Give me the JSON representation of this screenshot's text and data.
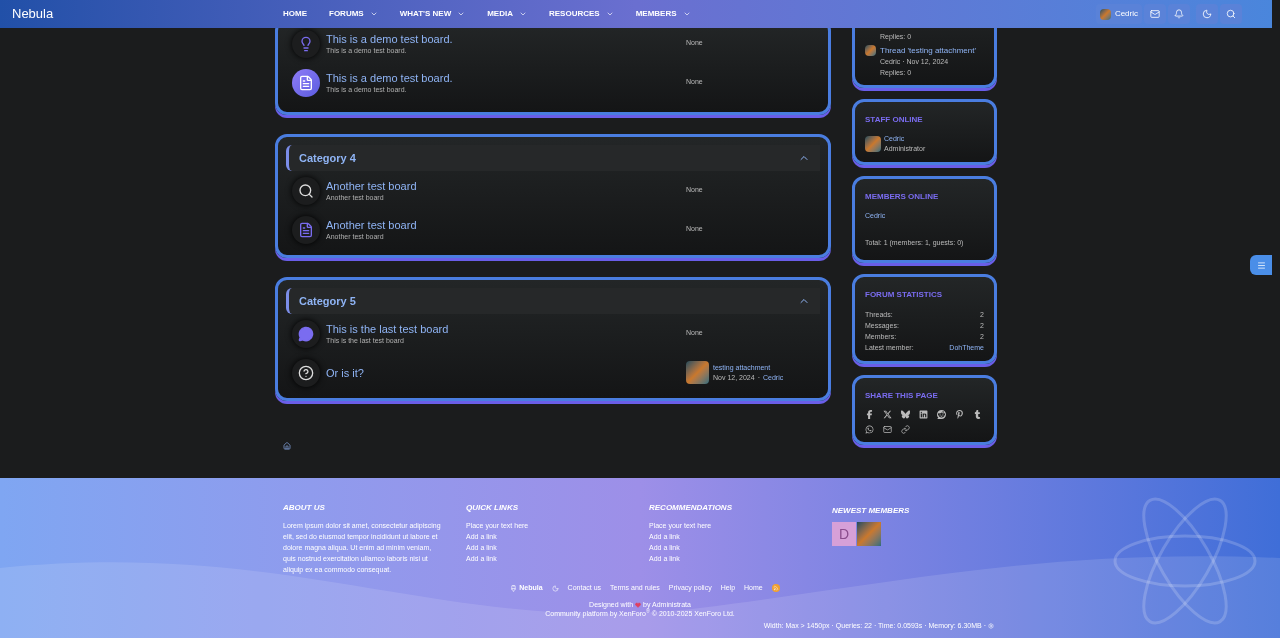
{
  "header": {
    "logo": "Nebula",
    "nav": [
      {
        "label": "HOME",
        "has_menu": false
      },
      {
        "label": "FORUMS",
        "has_menu": true
      },
      {
        "label": "WHAT'S NEW",
        "has_menu": true
      },
      {
        "label": "MEDIA",
        "has_menu": true
      },
      {
        "label": "RESOURCES",
        "has_menu": true
      },
      {
        "label": "MEMBERS",
        "has_menu": true
      }
    ],
    "user": "Cedric"
  },
  "categories": [
    {
      "boards": [
        {
          "highlighted": false,
          "title": "This is a demo test board.",
          "description": "This is a demo test board.",
          "last_post": {
            "kind": "none",
            "text": "None"
          }
        },
        {
          "highlighted": true,
          "title": "This is a demo test board.",
          "description": "This is a demo test board.",
          "last_post": {
            "kind": "none",
            "text": "None"
          }
        }
      ]
    },
    {
      "title": "Category 4",
      "boards": [
        {
          "highlighted": false,
          "title": "Another test board",
          "description": "Another test board",
          "last_post": {
            "kind": "none",
            "text": "None"
          }
        },
        {
          "highlighted": false,
          "title": "Another test board",
          "description": "Another test board",
          "last_post": {
            "kind": "none",
            "text": "None"
          }
        }
      ]
    },
    {
      "title": "Category 5",
      "boards": [
        {
          "highlighted": false,
          "title": "This is the last test board",
          "description": "This is the last test board",
          "last_post": {
            "kind": "none",
            "text": "None"
          }
        },
        {
          "highlighted": false,
          "title": "Or is it?",
          "last_post": {
            "kind": "post",
            "title": "testing attachment",
            "date": "Nov 12, 2024",
            "separator": "·",
            "user": "Cedric"
          }
        }
      ]
    }
  ],
  "sidebar": {
    "latest_posts": [
      {
        "replies": "Replies: 0"
      },
      {
        "title": "Thread 'testing attachment'",
        "meta": "Cedric · Nov 12, 2024",
        "replies": "Replies: 0"
      }
    ],
    "staff_online": {
      "title": "STAFF ONLINE",
      "name": "Cedric",
      "role": "Administrator"
    },
    "members_online": {
      "title": "MEMBERS ONLINE",
      "members": [
        "Cedric"
      ],
      "total": "Total: 1 (members: 1, guests: 0)"
    },
    "forum_statistics": {
      "title": "FORUM STATISTICS",
      "rows": [
        {
          "label": "Threads:",
          "value": "2",
          "kind": "plain"
        },
        {
          "label": "Messages:",
          "value": "2",
          "kind": "plain"
        },
        {
          "label": "Members:",
          "value": "2",
          "kind": "plain"
        },
        {
          "label": "Latest member:",
          "value": "DohTheme",
          "kind": "link"
        }
      ]
    },
    "share": {
      "title": "SHARE THIS PAGE"
    }
  },
  "footer": {
    "columns": [
      {
        "title": "ABOUT US",
        "text": "Lorem ipsum dolor sit amet, consectetur adipiscing elit, sed do eiusmod tempor incididunt ut labore et dolore magna aliqua. Ut enim ad minim veniam, quis nostrud exercitation ullamco laboris nisi ut aliquip ex ea commodo consequat."
      },
      {
        "title": "QUICK LINKS",
        "links": [
          "Place your text here",
          "Add a link",
          "Add a link",
          "Add a link"
        ]
      },
      {
        "title": "RECOMMENDATIONS",
        "links": [
          "Place your text here",
          "Add a link",
          "Add a link",
          "Add a link"
        ]
      }
    ],
    "newest_members": {
      "title": "NEWEST MEMBERS",
      "members": [
        {
          "kind": "letter",
          "letter": "D"
        },
        {
          "kind": "image"
        }
      ]
    },
    "style_name": "Nebula",
    "links": [
      "Contact us",
      "Terms and rules",
      "Privacy policy",
      "Help",
      "Home"
    ],
    "designed_prefix": "Designed with",
    "designed_suffix": "by Administrata",
    "copyright": "Community platform by XenForo$^{®}$ © 2010-2025 XenForo Ltd.",
    "debug": "Width: Max > 1450px · Queries: 22 · Time: 0.0593s · Memory: 6.30MB ·"
  }
}
